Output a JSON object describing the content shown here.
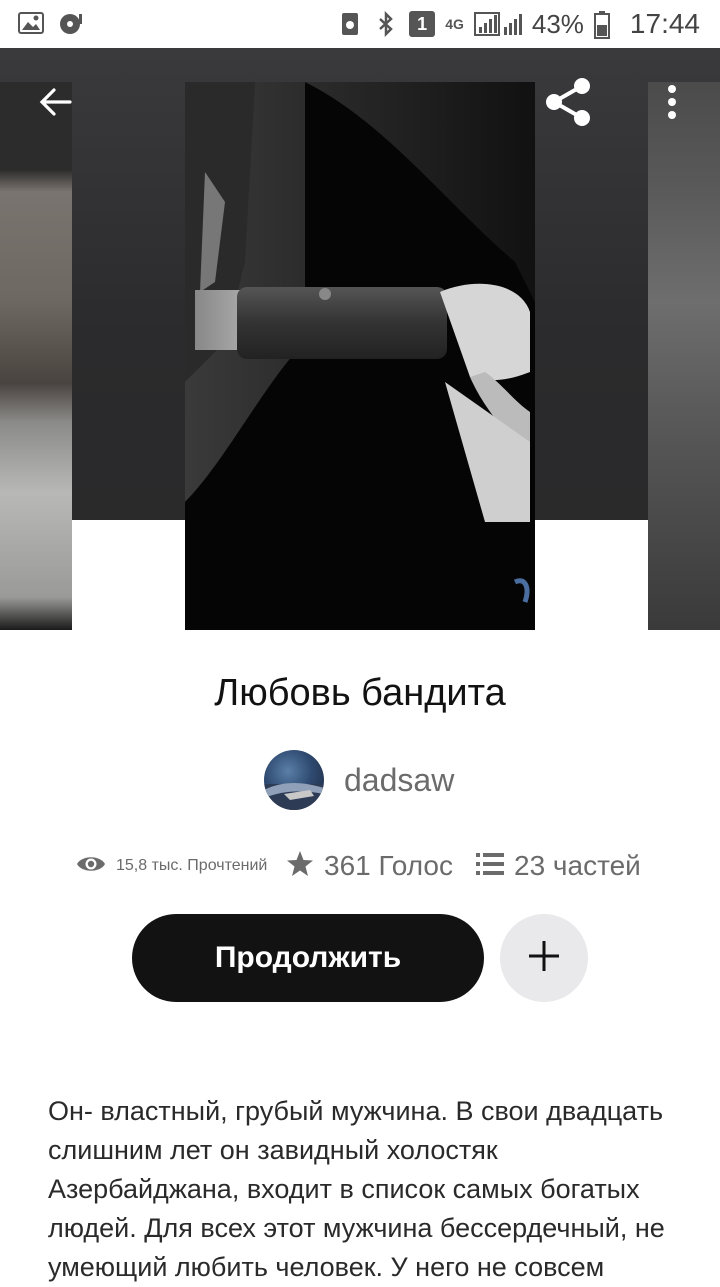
{
  "status_bar": {
    "network": "4G",
    "sim": "1",
    "battery": "43%",
    "time": "17:44",
    "icons": [
      "gallery-icon",
      "music-icon",
      "recycle-icon",
      "bluetooth-icon",
      "sim-icon",
      "signal-icon",
      "battery-icon"
    ]
  },
  "toolbar": {
    "back_icon": "arrow-left-icon",
    "share_icon": "share-icon",
    "more_icon": "more-vertical-icon"
  },
  "story": {
    "title": "Любовь бандита",
    "author": "dadsaw",
    "stats": {
      "reads": "15,8 тыс. Прочтений",
      "votes": "361 Голос",
      "parts": "23 частей"
    },
    "continue_label": "Продолжить",
    "add_icon": "plus-icon",
    "description": "Он- властный, грубый мужчина. В свои двадцать слишним лет он завидный холостяк Азербайджана, входит в список самых богатых людей. Для всех этот мужчина бессердечный, не умеющий любить человек. У него не совсем"
  },
  "colors": {
    "primary_button": "#121212",
    "add_button_bg": "#e9e8ea",
    "text_primary": "#121212",
    "text_secondary": "#6b6b6b"
  }
}
